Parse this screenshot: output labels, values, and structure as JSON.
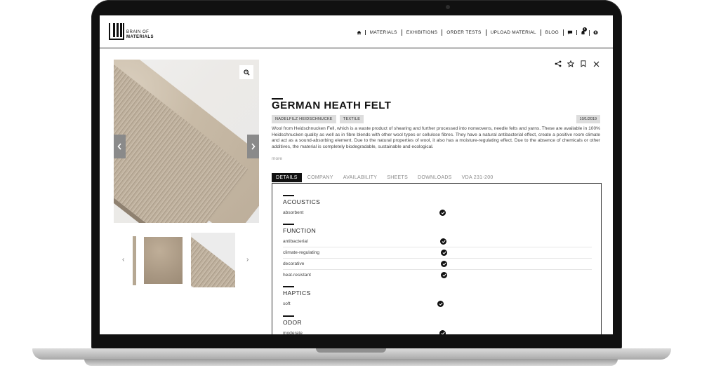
{
  "brand": {
    "line1": "BRAIN OF",
    "line2": "MATERIALS"
  },
  "nav": {
    "items": [
      "MATERIALS",
      "EXHIBITIONS",
      "ORDER TESTS",
      "UPLOAD MATERIAL",
      "BLOG"
    ],
    "icons": [
      "home-icon",
      "chat-icon",
      "bell-icon",
      "user-icon"
    ],
    "notification_count": "1"
  },
  "gallery": {
    "zoom_icon": "magnifier-icon",
    "prev_icon": "chevron-left-icon",
    "next_icon": "chevron-right-icon"
  },
  "material": {
    "title": "GERMAN HEATH FELT",
    "tags": [
      "NADELFILZ HEIDSCHNUCKE",
      "TEXTILE"
    ],
    "date": "10/1/2019",
    "description": "Wool from Heidschnucken Fell, which is a waste product of shearing and further processed into nonwovens, needle felts and yarns. These are available in 100% Heidschnucken quality as well as in fibre blends with other wool types or cellulose fibres. They have a natural antibacterial effect, create a positive room climate and act as a sound-absorbing element. Due to the natural properties of wool, it also has a moisture-regulating effect. Due to the absence of chemicals or other additives, the material is completely biodegradable, sustainable and ecological.",
    "more_label": "more"
  },
  "actions": [
    "share-icon",
    "star-icon",
    "bookmark-icon",
    "close-icon"
  ],
  "tabs": [
    "DETAILS",
    "COMPANY",
    "AVAILABILITY",
    "SHEETS",
    "DOWNLOADS",
    "VDA 231-200"
  ],
  "details": {
    "acoustics": {
      "title": "ACOUSTICS",
      "rows": [
        "absorbent"
      ]
    },
    "function": {
      "title": "FUNCTION",
      "rows": [
        "antibacterial",
        "climate-regulating",
        "decorative",
        "heat-resistant"
      ]
    },
    "haptics": {
      "title": "HAPTICS",
      "rows": [
        "soft"
      ]
    },
    "odor": {
      "title": "ODOR",
      "rows": [
        "moderate"
      ]
    }
  }
}
